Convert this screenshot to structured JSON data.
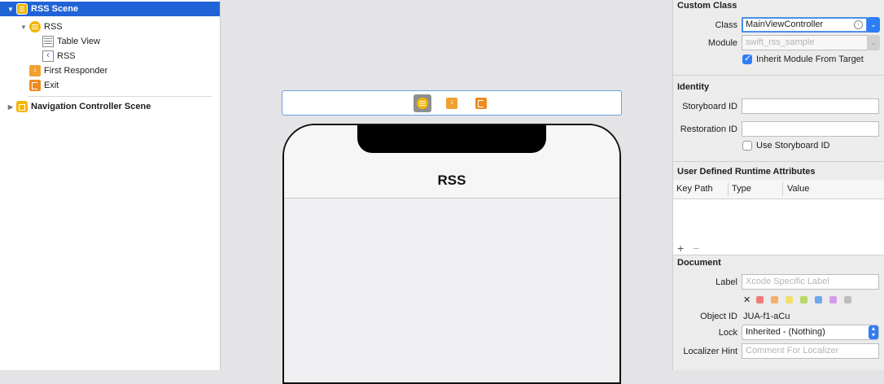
{
  "outline": {
    "items": [
      {
        "label": "RSS Scene"
      },
      {
        "label": "RSS"
      },
      {
        "label": "Table View"
      },
      {
        "label": "RSS"
      },
      {
        "label": "First Responder"
      },
      {
        "label": "Exit"
      },
      {
        "label": "Navigation Controller Scene"
      }
    ]
  },
  "canvas": {
    "nav_title": "RSS"
  },
  "inspector": {
    "custom_class": {
      "title": "Custom Class",
      "class_label": "Class",
      "class_value": "MainViewController",
      "module_label": "Module",
      "module_placeholder": "swift_rss_sample",
      "inherit_label": "Inherit Module From Target",
      "inherit_checked": true
    },
    "identity": {
      "title": "Identity",
      "storyboard_id_label": "Storyboard ID",
      "storyboard_id_value": "",
      "restoration_id_label": "Restoration ID",
      "restoration_id_value": "",
      "use_storyboard_id_label": "Use Storyboard ID",
      "use_storyboard_id_checked": false
    },
    "runtime_attributes": {
      "title": "User Defined Runtime Attributes",
      "columns": [
        "Key Path",
        "Type",
        "Value"
      ],
      "add_label": "+",
      "remove_label": "−"
    },
    "document": {
      "title": "Document",
      "label_label": "Label",
      "label_placeholder": "Xcode Specific Label",
      "clear_label": "✕",
      "swatch_colors": [
        "#f27a7a",
        "#f5b06a",
        "#f1df6b",
        "#b9d96a",
        "#6fa8ef",
        "#d49be8",
        "#bdbdbd"
      ],
      "object_id_label": "Object ID",
      "object_id_value": "JUA-f1-aCu",
      "lock_label": "Lock",
      "lock_value": "Inherited - (Nothing)",
      "localizer_hint_label": "Localizer Hint",
      "localizer_hint_placeholder": "Comment For Localizer"
    }
  }
}
